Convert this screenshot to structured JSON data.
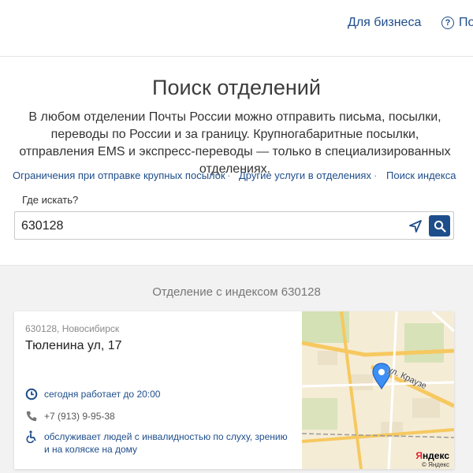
{
  "header": {
    "business_link": "Для бизнеса",
    "help_label": "По"
  },
  "page": {
    "title": "Поиск отделений",
    "description": "В любом отделении Почты России можно отправить письма, посылки, переводы по России и за границу. Крупногабаритные посылки, отправления EMS и экспресс-переводы — только в специализированных отделениях."
  },
  "links": {
    "large_parcels": "Ограничения при отправке крупных посылок",
    "other_services": "Другие услуги в отделениях",
    "index_search": "Поиск индекса",
    "separator": "·"
  },
  "search": {
    "label": "Где искать?",
    "value": "630128",
    "placeholder": ""
  },
  "results": {
    "title": "Отделение с индексом 630128",
    "office": {
      "city": "630128, Новосибирск",
      "street": "Тюленина ул, 17",
      "hours": "сегодня работает до 20:00",
      "phone": "+7 (913) 9-95-38",
      "accessibility": "обслуживает людей с инвалидностью по слуху, зрению и на коляске на дому"
    },
    "map": {
      "street_label": "ул. Краузе",
      "brand_prefix": "Я",
      "brand_rest": "ндекс",
      "brand_sub": "© Яндекс"
    }
  },
  "colors": {
    "brand_blue": "#1e4d8b",
    "map_pin": "#3d8ff5",
    "map_road": "#f6c85f",
    "map_park": "#cfe0b0"
  },
  "icons": {
    "help": "question-circle-icon",
    "geolocation": "location-arrow-icon",
    "search": "magnifier-icon",
    "clock": "clock-icon",
    "phone": "phone-icon",
    "accessibility": "wheelchair-icon",
    "map_pin": "map-pin-icon"
  }
}
